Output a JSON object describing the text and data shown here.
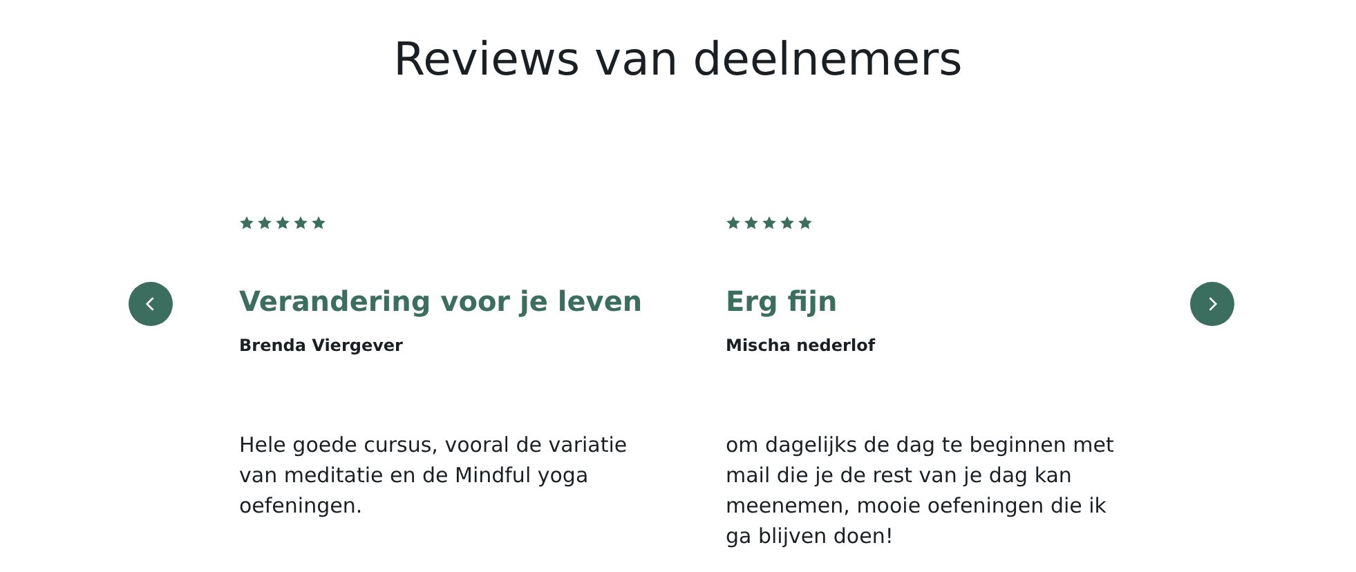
{
  "heading": "Reviews van deelnemers",
  "reviews": [
    {
      "stars": 5,
      "title": "Verandering voor je leven",
      "author": "Brenda Viergever",
      "text": "Hele goede cursus, vooral de variatie van meditatie en de Mindful yoga oefeningen."
    },
    {
      "stars": 5,
      "title": "Erg fijn",
      "author": "Mischa nederlof",
      "text": "om dagelijks de dag te beginnen met mail die je de rest van je dag kan meenemen, mooie oefeningen die ik ga blijven doen!"
    }
  ]
}
